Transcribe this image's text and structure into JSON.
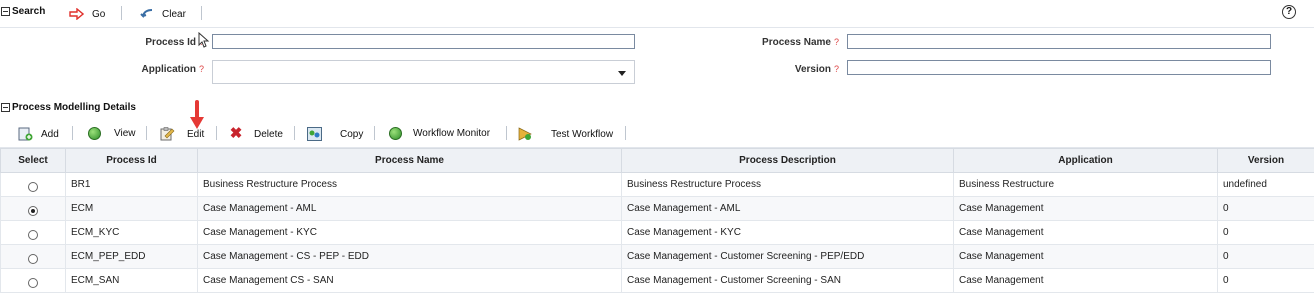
{
  "search": {
    "title": "Search",
    "go_label": "Go",
    "clear_label": "Clear",
    "help": "?"
  },
  "form": {
    "process_id_label": "Process Id",
    "process_name_label": "Process Name",
    "application_label": "Application",
    "version_label": "Version",
    "required_mark": "?",
    "process_id_value": "",
    "process_name_value": "",
    "application_value": "",
    "version_value": ""
  },
  "details": {
    "title": "Process Modelling Details",
    "toolbar": {
      "add": "Add",
      "view": "View",
      "edit": "Edit",
      "delete": "Delete",
      "copy": "Copy",
      "workflow_monitor": "Workflow Monitor",
      "test_workflow": "Test Workflow"
    }
  },
  "grid": {
    "columns": [
      "Select",
      "Process Id",
      "Process Name",
      "Process Description",
      "Application",
      "Version"
    ],
    "rows": [
      {
        "selected": false,
        "process_id": "BR1",
        "process_name": "Business Restructure Process",
        "description": "Business Restructure Process",
        "application": "Business Restructure",
        "version": "undefined"
      },
      {
        "selected": true,
        "process_id": "ECM",
        "process_name": "Case Management - AML",
        "description": "Case Management - AML",
        "application": "Case Management",
        "version": "0"
      },
      {
        "selected": false,
        "process_id": "ECM_KYC",
        "process_name": "Case Management - KYC",
        "description": "Case Management - KYC",
        "application": "Case Management",
        "version": "0"
      },
      {
        "selected": false,
        "process_id": "ECM_PEP_EDD",
        "process_name": "Case Management - CS - PEP - EDD",
        "description": "Case Management - Customer Screening - PEP/EDD",
        "application": "Case Management",
        "version": "0"
      },
      {
        "selected": false,
        "process_id": "ECM_SAN",
        "process_name": "Case Management CS - SAN",
        "description": "Case Management - Customer Screening - SAN",
        "application": "Case Management",
        "version": "0"
      }
    ]
  },
  "colors": {
    "header_bg": "#eef1f5",
    "border": "#d6dbe2",
    "go_arrow": "#e0302c",
    "annotation_arrow": "#e53935"
  }
}
